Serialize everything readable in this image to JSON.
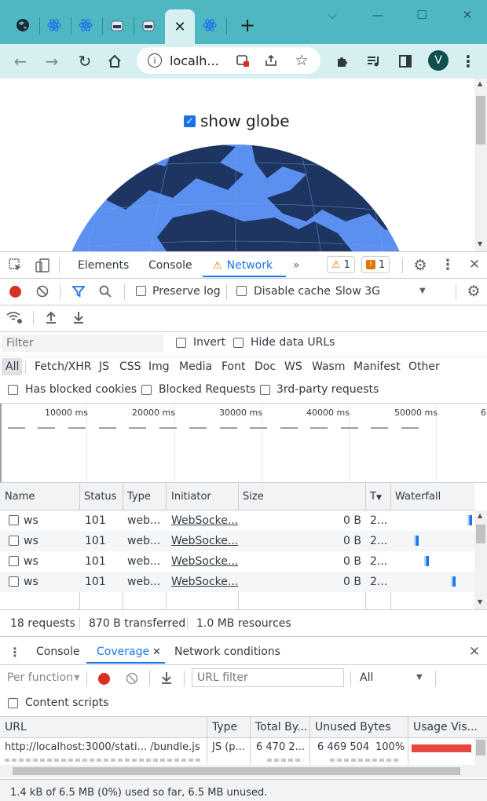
{
  "browser": {
    "url_display": "localh...",
    "avatar_letter": "V"
  },
  "page": {
    "checkbox_label": "show globe"
  },
  "devtools": {
    "tabs": [
      "Elements",
      "Console",
      "Network"
    ],
    "more_tabs": "»",
    "warnings_count": "1",
    "issues_count": "1",
    "toolbar": {
      "preserve_log": "Preserve log",
      "disable_cache": "Disable cache",
      "throttle": "Slow 3G"
    },
    "filter": {
      "placeholder": "Filter",
      "invert": "Invert",
      "hide_data_urls": "Hide data URLs"
    },
    "type_filters": [
      "All",
      "Fetch/XHR",
      "JS",
      "CSS",
      "Img",
      "Media",
      "Font",
      "Doc",
      "WS",
      "Wasm",
      "Manifest",
      "Other"
    ],
    "blocked": {
      "has_blocked_cookies": "Has blocked cookies",
      "blocked_requests": "Blocked Requests",
      "third_party": "3rd-party requests"
    },
    "timeline_ticks": [
      "10000 ms",
      "20000 ms",
      "30000 ms",
      "40000 ms",
      "50000 ms",
      "6"
    ],
    "table": {
      "columns": [
        "Name",
        "Status",
        "Type",
        "Initiator",
        "Size",
        "T",
        "Waterfall"
      ],
      "rows": [
        {
          "name": "ws",
          "status": "101",
          "type": "web...",
          "initiator": "WebSocke...",
          "size": "0 B",
          "time": "2...",
          "bar": 0.97
        },
        {
          "name": "ws",
          "status": "101",
          "type": "web...",
          "initiator": "WebSocke...",
          "size": "0 B",
          "time": "2...",
          "bar": 0.3
        },
        {
          "name": "ws",
          "status": "101",
          "type": "web...",
          "initiator": "WebSocke...",
          "size": "0 B",
          "time": "2...",
          "bar": 0.43
        },
        {
          "name": "ws",
          "status": "101",
          "type": "web...",
          "initiator": "WebSocke...",
          "size": "0 B",
          "time": "2...",
          "bar": 0.76
        }
      ]
    },
    "summary": {
      "requests": "18 requests",
      "transferred": "870 B transferred",
      "resources": "1.0 MB resources"
    }
  },
  "drawer": {
    "tabs": [
      "Console",
      "Coverage",
      "Network conditions"
    ],
    "per_function": "Per function",
    "url_filter_placeholder": "URL filter",
    "type_select": "All",
    "content_scripts": "Content scripts",
    "columns": [
      "URL",
      "Type",
      "Total By...",
      "Unused Bytes",
      "Usage Vis..."
    ],
    "rows": [
      {
        "url": "http://localhost:3000/stati... /bundle.js",
        "type": "JS (p...",
        "total": "6 470 2...",
        "unused": "6 469 504",
        "percent": "100%",
        "usage": 0.98
      }
    ],
    "status": "1.4 kB of 6.5 MB (0%) used so far, 6.5 MB unused."
  },
  "colors": {
    "tab_strip": "#4fb7c1",
    "toolbar": "#d6f0f2",
    "accent": "#1a73e8",
    "record": "#d93025",
    "globe_ocean": "#5b8ff0",
    "globe_land": "#1f3561",
    "usage_bar": "#e8453c"
  }
}
